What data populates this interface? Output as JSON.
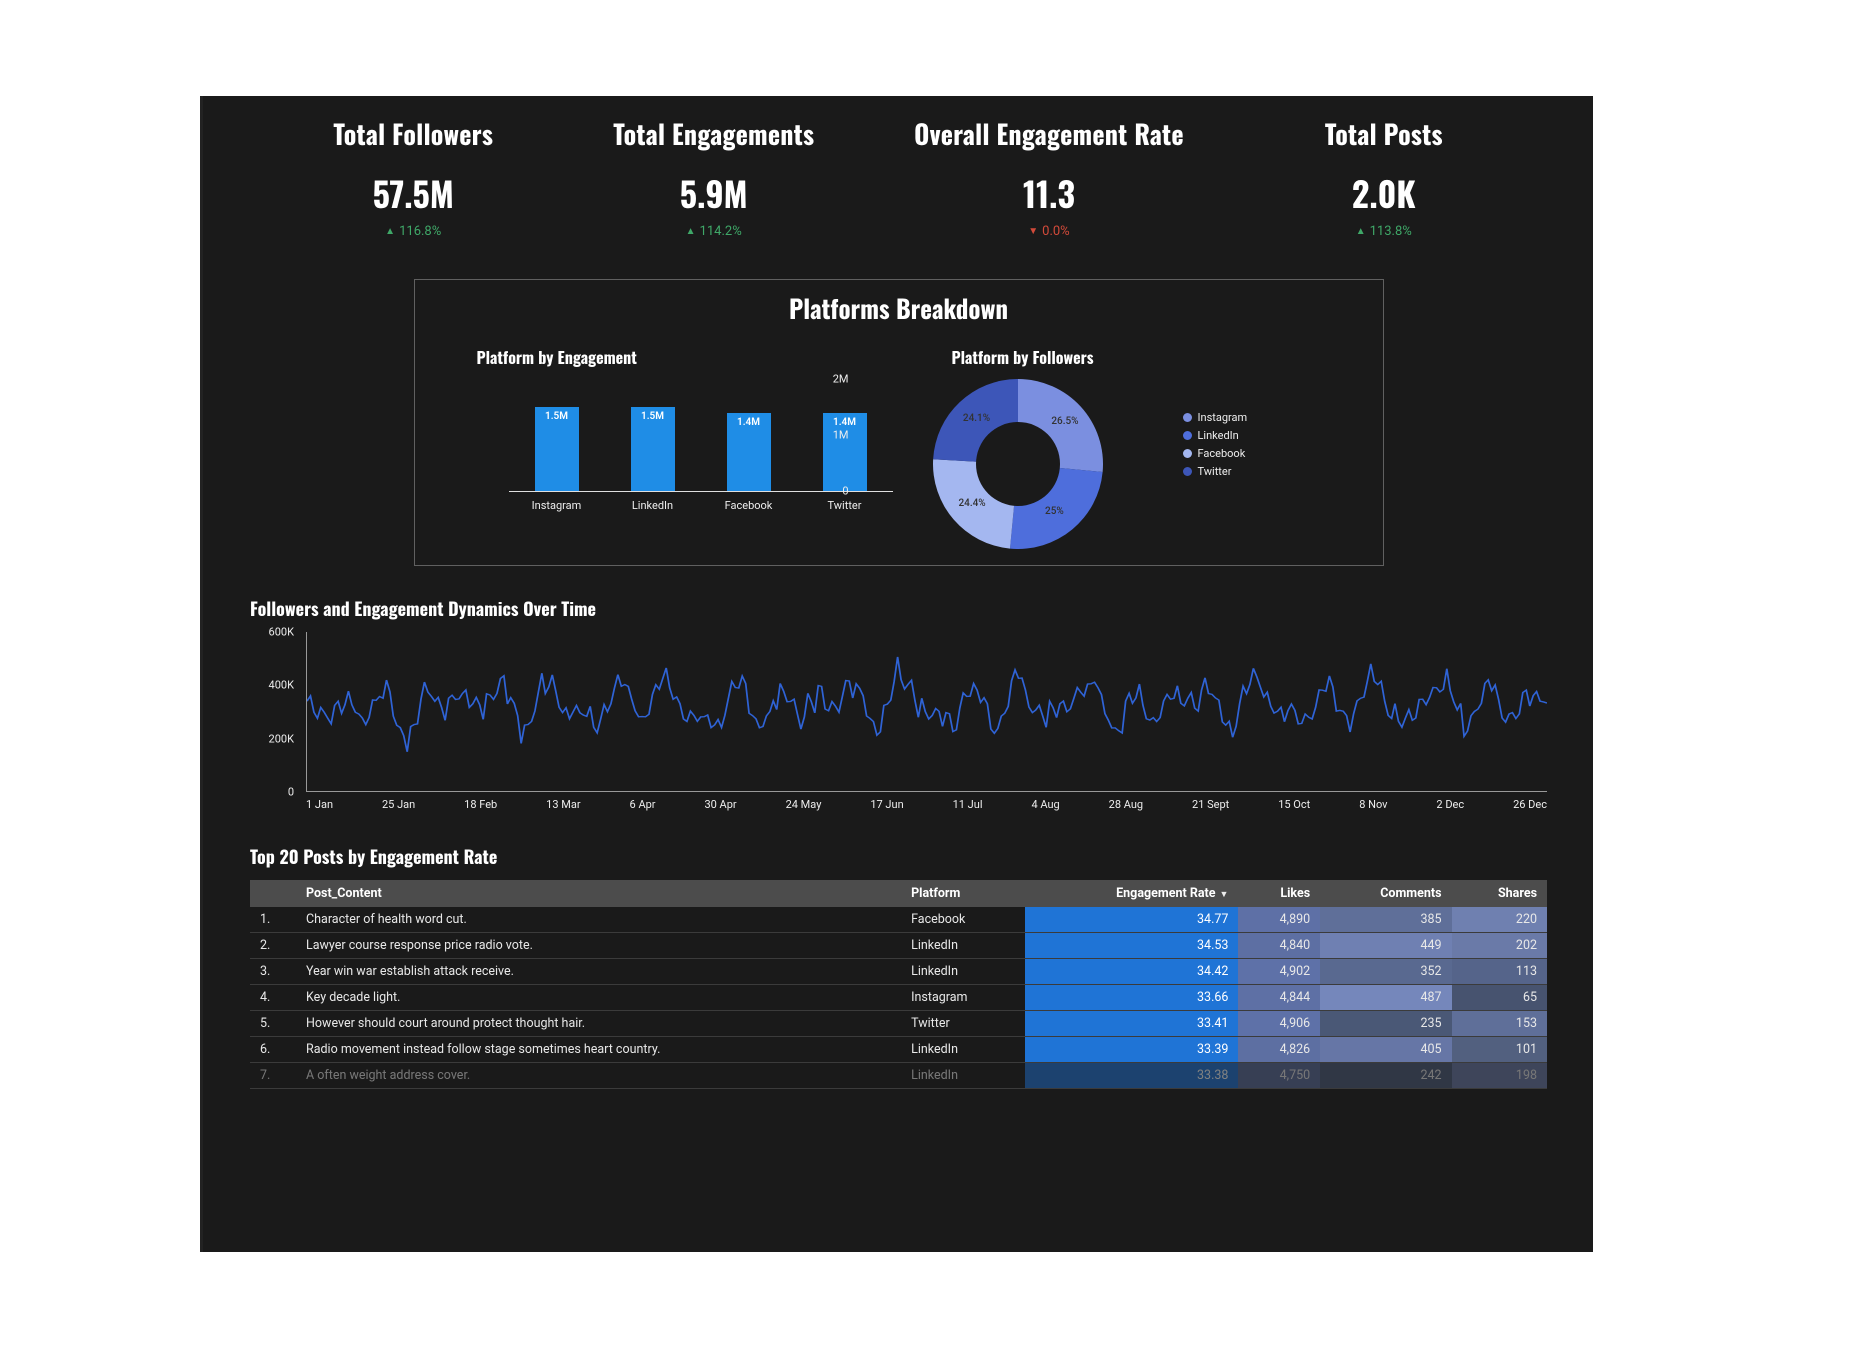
{
  "kpis": [
    {
      "title": "Total Followers",
      "value": "57.5M",
      "delta": "116.8%",
      "dir": "up"
    },
    {
      "title": "Total Engagements",
      "value": "5.9M",
      "delta": "114.2%",
      "dir": "up"
    },
    {
      "title": "Overall Engagement Rate",
      "value": "11.3",
      "delta": "0.0%",
      "dir": "down"
    },
    {
      "title": "Total Posts",
      "value": "2.0K",
      "delta": "113.8%",
      "dir": "up"
    }
  ],
  "platforms_panel_title": "Platforms Breakdown",
  "bar_chart_title": "Platform by Engagement",
  "donut_chart_title": "Platform by Followers",
  "timeseries_title": "Followers and Engagement Dynamics Over Time",
  "table_title": "Top 20 Posts by Engagement Rate",
  "chart_data": [
    {
      "id": "platform_engagement_bar",
      "type": "bar",
      "title": "Platform by Engagement",
      "categories": [
        "Instagram",
        "LinkedIn",
        "Facebook",
        "Twitter"
      ],
      "value_labels": [
        "1.5M",
        "1.5M",
        "1.4M",
        "1.4M"
      ],
      "values_millions": [
        1.5,
        1.5,
        1.4,
        1.4
      ],
      "yticks": [
        "0",
        "1M",
        "2M"
      ],
      "ylim_millions": [
        0,
        2
      ]
    },
    {
      "id": "platform_followers_donut",
      "type": "pie",
      "title": "Platform by Followers",
      "series": [
        {
          "name": "Instagram",
          "pct": 26.5,
          "color": "#7b8fe0"
        },
        {
          "name": "LinkedIn",
          "pct": 25.0,
          "color": "#4e6edc"
        },
        {
          "name": "Facebook",
          "pct": 24.4,
          "color": "#a4b7f0"
        },
        {
          "name": "Twitter",
          "pct": 24.1,
          "color": "#3d56b8"
        }
      ],
      "slice_labels": [
        "26.5%",
        "25%",
        "24.4%",
        "24.1%"
      ]
    },
    {
      "id": "followers_engagement_timeseries",
      "type": "line",
      "title": "Followers and Engagement Dynamics Over Time",
      "ylabel": "",
      "ylim": [
        0,
        600000
      ],
      "yticks": [
        "0",
        "200K",
        "400K",
        "600K"
      ],
      "xticks": [
        "1 Jan",
        "25 Jan",
        "18 Feb",
        "13 Mar",
        "6 Apr",
        "30 Apr",
        "24 May",
        "17 Jun",
        "11 Jul",
        "4 Aug",
        "28 Aug",
        "21 Sept",
        "15 Oct",
        "8 Nov",
        "2 Dec",
        "26 Dec"
      ],
      "note": "High-frequency noisy line roughly between 150K and 450K across the full year; values approximated from pixels.",
      "approx_samples_thousands": [
        310,
        240,
        400,
        270,
        350,
        220,
        390,
        260,
        420,
        300,
        370,
        250,
        410,
        280,
        350,
        240,
        390,
        300,
        420,
        260,
        340,
        230,
        400,
        280,
        360,
        250,
        410,
        300,
        370,
        260,
        430,
        290,
        350,
        230,
        390,
        270,
        420,
        250,
        360,
        300,
        400,
        270,
        340,
        240,
        410,
        290,
        370,
        250,
        430,
        300,
        360,
        240,
        390,
        280,
        420,
        260,
        350,
        300,
        400,
        270,
        370,
        240,
        410,
        290
      ]
    }
  ],
  "table": {
    "columns": [
      "Post_Content",
      "Platform",
      "Engagement Rate",
      "Likes",
      "Comments",
      "Shares"
    ],
    "sort_col_index": 2,
    "sort_dir": "desc",
    "rows": [
      {
        "idx": "1.",
        "content": "Character of health word cut.",
        "platform": "Facebook",
        "er": "34.77",
        "likes": "4,890",
        "comments": "385",
        "shares": "220"
      },
      {
        "idx": "2.",
        "content": "Lawyer course response price radio vote.",
        "platform": "LinkedIn",
        "er": "34.53",
        "likes": "4,840",
        "comments": "449",
        "shares": "202"
      },
      {
        "idx": "3.",
        "content": "Year win war establish attack receive.",
        "platform": "LinkedIn",
        "er": "34.42",
        "likes": "4,902",
        "comments": "352",
        "shares": "113"
      },
      {
        "idx": "4.",
        "content": "Key decade light.",
        "platform": "Instagram",
        "er": "33.66",
        "likes": "4,844",
        "comments": "487",
        "shares": "65"
      },
      {
        "idx": "5.",
        "content": "However should court around protect thought hair.",
        "platform": "Twitter",
        "er": "33.41",
        "likes": "4,906",
        "comments": "235",
        "shares": "153"
      },
      {
        "idx": "6.",
        "content": "Radio movement instead follow stage sometimes heart country.",
        "platform": "LinkedIn",
        "er": "33.39",
        "likes": "4,826",
        "comments": "405",
        "shares": "101"
      },
      {
        "idx": "7.",
        "content": "A often weight address cover.",
        "platform": "LinkedIn",
        "er": "33.38",
        "likes": "4,750",
        "comments": "242",
        "shares": "198"
      }
    ],
    "heat": {
      "likes_colors": [
        "#5e70a6",
        "#5d6fa3",
        "#5e71a8",
        "#5e70a5",
        "#5e71a8",
        "#5d6fa2",
        "#5b6c9c"
      ],
      "comments_colors": [
        "#5f6f99",
        "#6f80b2",
        "#596990",
        "#7587bb",
        "#4a5876",
        "#6676a6",
        "#4c5a7a"
      ],
      "shares_colors": [
        "#6f80b0",
        "#6a7aa8",
        "#55648a",
        "#47536f",
        "#5f6f99",
        "#52607f",
        "#6a7aa8"
      ]
    }
  },
  "colors": {
    "line": "#2f63d6",
    "bar": "#1f8de6",
    "up": "#3fa868",
    "down": "#d24a3a"
  }
}
